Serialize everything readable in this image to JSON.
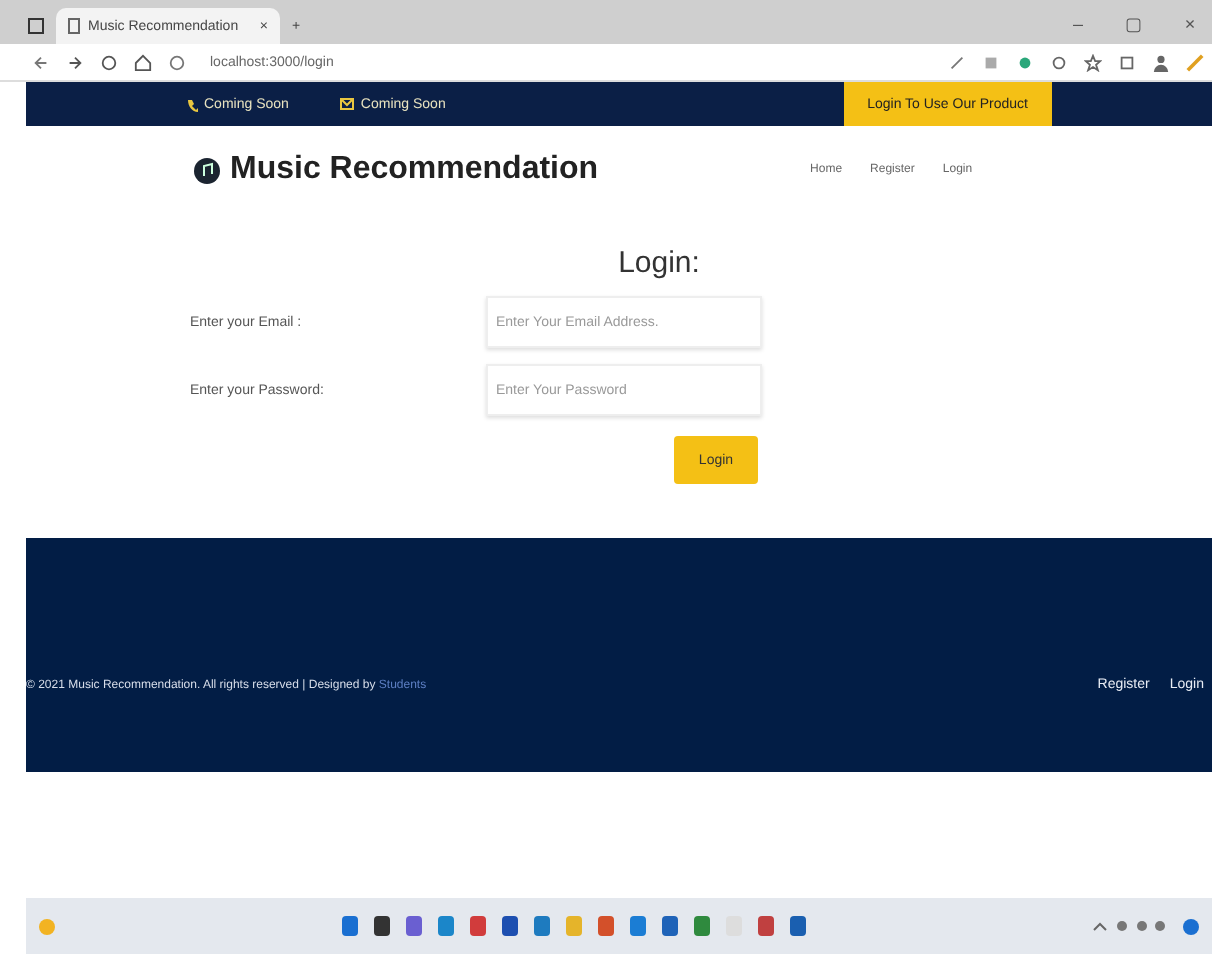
{
  "browser": {
    "tab_title": "Music Recommendation",
    "tab_close": "×",
    "new_tab": "+",
    "url": "localhost:3000/login",
    "window_controls": [
      "–",
      "▢",
      "×"
    ]
  },
  "top_bar": {
    "contacts": [
      {
        "kind": "phone",
        "label": "Coming Soon"
      },
      {
        "kind": "mail",
        "label": "Coming Soon"
      }
    ],
    "cta": "Login To Use Our Product"
  },
  "header": {
    "brand": "Music Recommendation",
    "nav": [
      {
        "label": "Home"
      },
      {
        "label": "Register"
      },
      {
        "label": "Login"
      }
    ]
  },
  "form": {
    "title": "Login:",
    "fields": [
      {
        "label": "Enter your Email :",
        "placeholder": "Enter Your Email Address."
      },
      {
        "label": "Enter your Password:",
        "placeholder": "Enter Your Password"
      }
    ],
    "submit": "Login"
  },
  "footer": {
    "copyright": "© 2021 Music Recommendation. All rights reserved | Designed by **Students**",
    "links": [
      "Register",
      "Login"
    ]
  }
}
